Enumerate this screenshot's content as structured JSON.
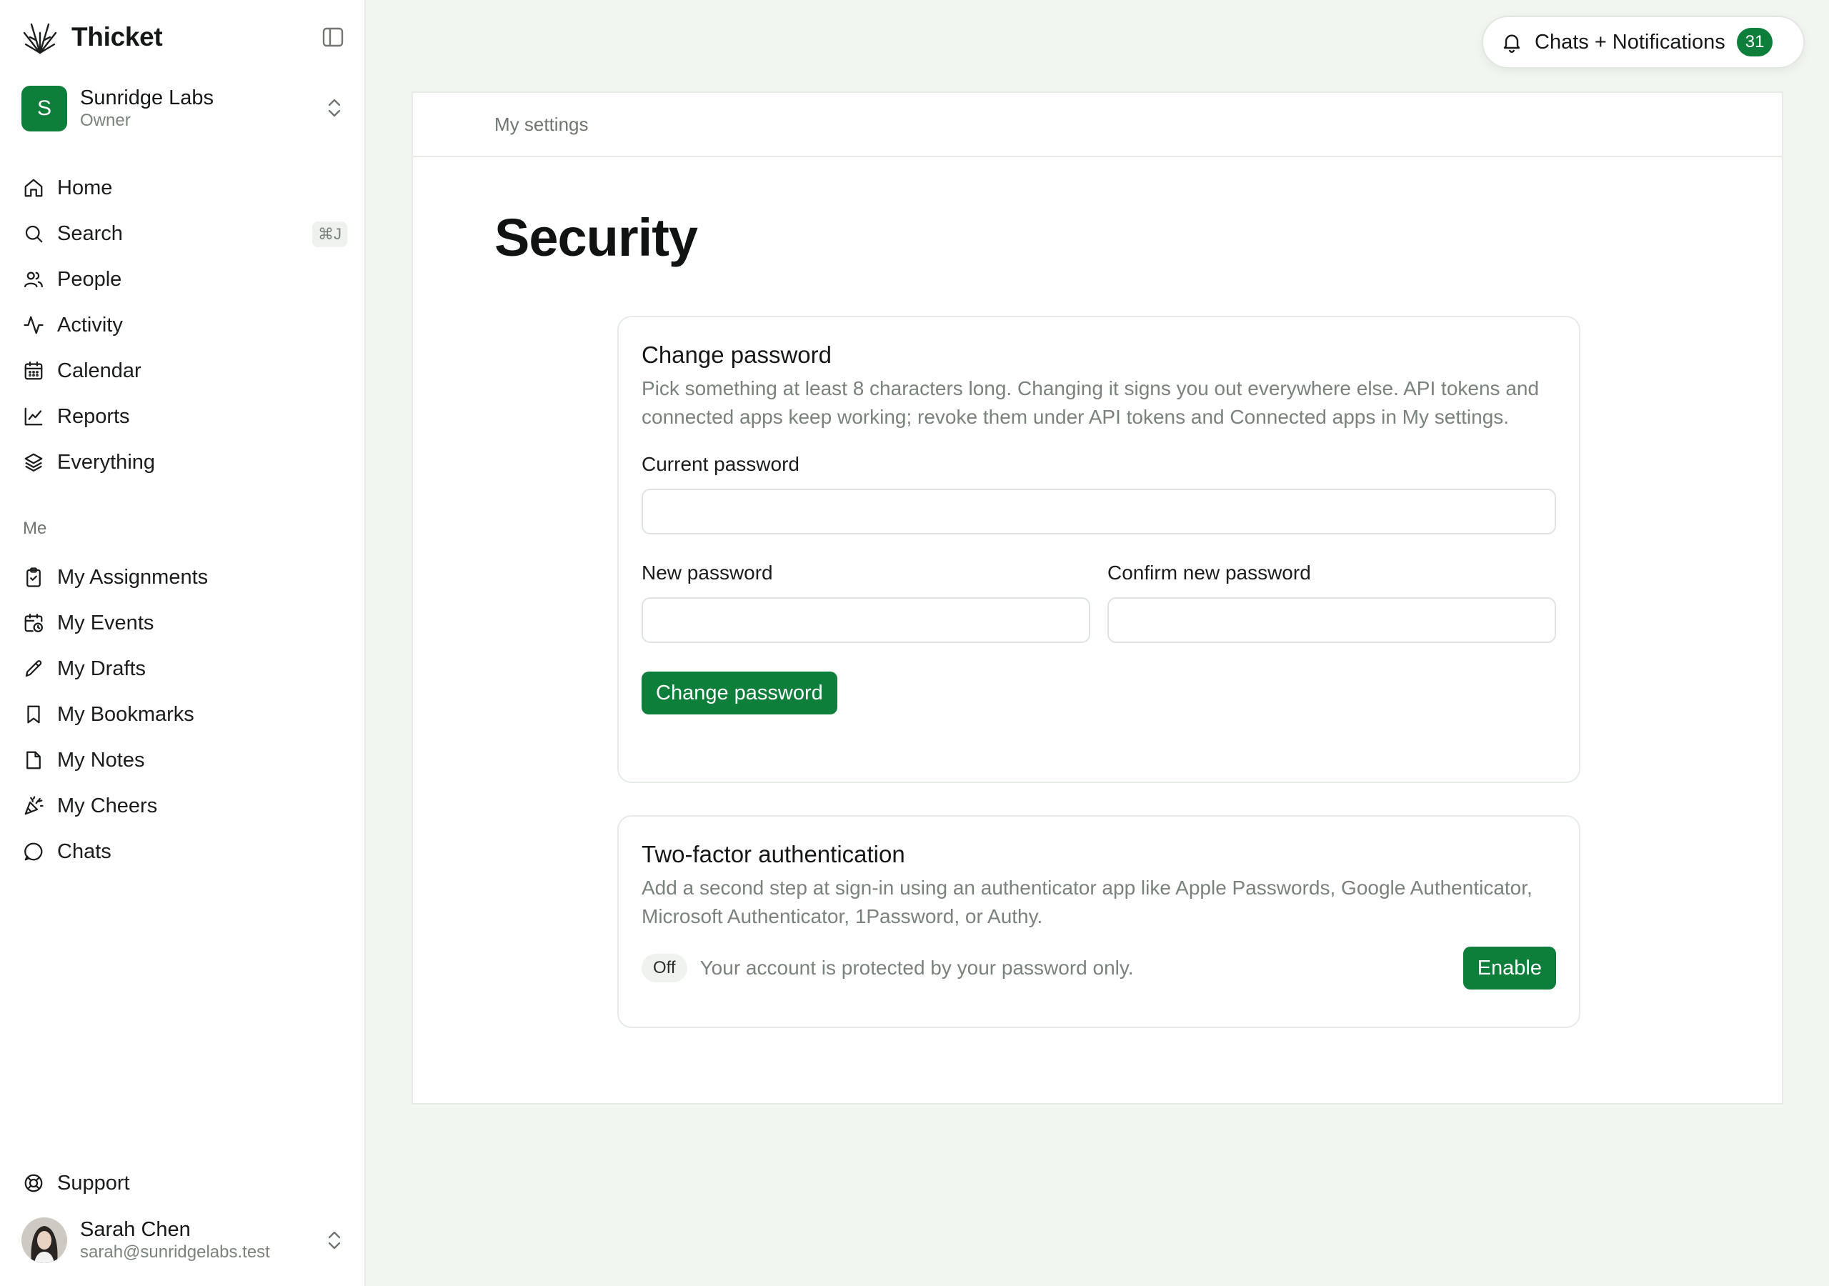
{
  "app": {
    "name": "Thicket"
  },
  "workspace": {
    "initial": "S",
    "name": "Sunridge Labs",
    "role": "Owner"
  },
  "nav": {
    "primary": [
      {
        "label": "Home",
        "icon": "home-icon"
      },
      {
        "label": "Search",
        "icon": "search-icon",
        "shortcut": "⌘J"
      },
      {
        "label": "People",
        "icon": "people-icon"
      },
      {
        "label": "Activity",
        "icon": "activity-icon"
      },
      {
        "label": "Calendar",
        "icon": "calendar-icon"
      },
      {
        "label": "Reports",
        "icon": "chart-icon"
      },
      {
        "label": "Everything",
        "icon": "layers-icon"
      }
    ],
    "me_label": "Me",
    "me": [
      {
        "label": "My Assignments",
        "icon": "clipboard-icon"
      },
      {
        "label": "My Events",
        "icon": "calendar-clock-icon"
      },
      {
        "label": "My Drafts",
        "icon": "pencil-icon"
      },
      {
        "label": "My Bookmarks",
        "icon": "bookmark-icon"
      },
      {
        "label": "My Notes",
        "icon": "note-icon"
      },
      {
        "label": "My Cheers",
        "icon": "party-popper-icon"
      },
      {
        "label": "Chats",
        "icon": "chat-bubble-icon"
      }
    ],
    "support": {
      "label": "Support",
      "icon": "lifebuoy-icon"
    }
  },
  "user": {
    "name": "Sarah Chen",
    "email": "sarah@sunridgelabs.test"
  },
  "notifications": {
    "label": "Chats + Notifications",
    "count": "31"
  },
  "page": {
    "breadcrumb": "My settings",
    "title": "Security"
  },
  "change_password": {
    "title": "Change password",
    "description": "Pick something at least 8 characters long. Changing it signs you out everywhere else. API tokens and connected apps keep working; revoke them under API tokens and Connected apps in My settings.",
    "current_label": "Current password",
    "current_value": "",
    "new_label": "New password",
    "new_value": "",
    "confirm_label": "Confirm new password",
    "confirm_value": "",
    "submit_label": "Change password"
  },
  "two_factor": {
    "title": "Two-factor authentication",
    "description": "Add a second step at sign-in using an authenticator app like Apple Passwords, Google Authenticator, Microsoft Authenticator, 1Password, or Authy.",
    "status": "Off",
    "status_text": "Your account is protected by your password only.",
    "enable_label": "Enable"
  },
  "colors": {
    "accent": "#0e7f3a",
    "background": "#f1f6f1",
    "muted_text": "#7a837b"
  }
}
